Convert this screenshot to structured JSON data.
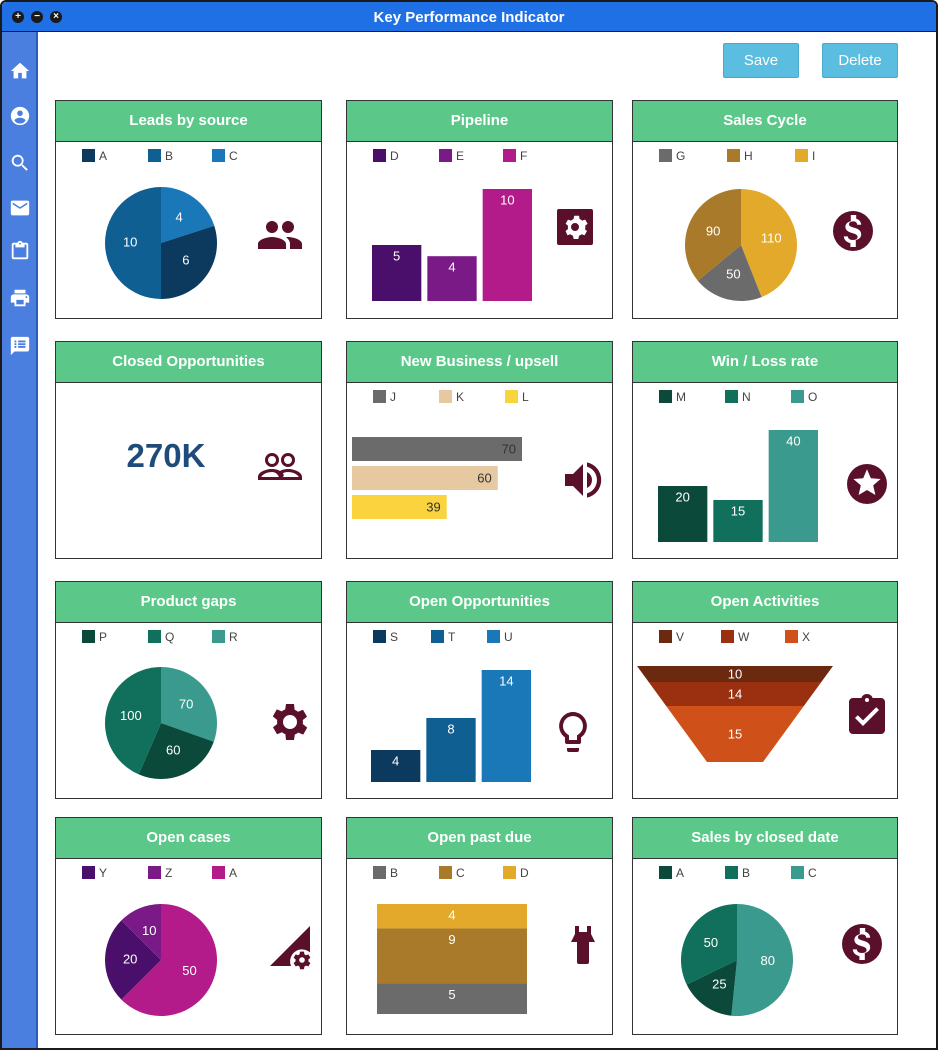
{
  "window": {
    "title": "Key Performance Indicator"
  },
  "toolbar": {
    "save_label": "Save",
    "delete_label": "Delete"
  },
  "sidebar": {
    "icons": [
      "home-icon",
      "user-circle-icon",
      "search-icon",
      "mail-icon",
      "clipboard-icon",
      "printer-icon",
      "message-list-icon"
    ]
  },
  "colors": {
    "header": "#5bc88a",
    "titlebar": "#1f6fe5",
    "sidebar": "#4a7fe0",
    "button": "#5bbddf",
    "icon": "#5a0f2b"
  },
  "panels": [
    {
      "title": "Leads by source",
      "legend": [
        "A",
        "B",
        "C"
      ],
      "icon": "people-icon"
    },
    {
      "title": "Pipeline",
      "legend": [
        "D",
        "E",
        "F"
      ],
      "icon": "gear-icon"
    },
    {
      "title": "Sales Cycle",
      "legend": [
        "G",
        "H",
        "I"
      ],
      "icon": "dollar-icon"
    },
    {
      "title": "Closed Opportunities",
      "legend": [],
      "icon": "people-outline-icon",
      "kpi": "270K"
    },
    {
      "title": "New Business / upsell",
      "legend": [
        "J",
        "K",
        "L"
      ],
      "icon": "speaker-icon"
    },
    {
      "title": "Win / Loss rate",
      "legend": [
        "M",
        "N",
        "O"
      ],
      "icon": "star-icon"
    },
    {
      "title": "Product gaps",
      "legend": [
        "P",
        "Q",
        "R"
      ],
      "icon": "gear-icon"
    },
    {
      "title": "Open Opportunities",
      "legend": [
        "S",
        "T",
        "U"
      ],
      "icon": "lightbulb-icon"
    },
    {
      "title": "Open Activities",
      "legend": [
        "V",
        "W",
        "X"
      ],
      "icon": "clipboard-check-icon"
    },
    {
      "title": "Open cases",
      "legend": [
        "Y",
        "Z",
        "A"
      ],
      "icon": "triangle-gear-icon"
    },
    {
      "title": "Open past due",
      "legend": [
        "B",
        "C",
        "D"
      ],
      "icon": "lamp-icon"
    },
    {
      "title": "Sales by closed date",
      "legend": [
        "A",
        "B",
        "C"
      ],
      "icon": "dollar-icon"
    }
  ],
  "chart_data": [
    {
      "type": "pie",
      "categories": [
        "A",
        "B",
        "C"
      ],
      "values": [
        6,
        10,
        4
      ],
      "colors": [
        "#0b3a5e",
        "#0f5f93",
        "#1a78b8"
      ]
    },
    {
      "type": "bar",
      "categories": [
        "D",
        "E",
        "F"
      ],
      "values": [
        5,
        4,
        10
      ],
      "colors": [
        "#4a0f6a",
        "#7a1a86",
        "#b31b8a"
      ]
    },
    {
      "type": "pie",
      "categories": [
        "G",
        "H",
        "I"
      ],
      "values": [
        50,
        90,
        110
      ],
      "colors": [
        "#6b6b6b",
        "#a87a2a",
        "#e3a92a"
      ]
    },
    {
      "type": "kpi",
      "value": "270K"
    },
    {
      "type": "bar",
      "orientation": "horizontal",
      "categories": [
        "J",
        "K",
        "L"
      ],
      "values": [
        70,
        60,
        39
      ],
      "colors": [
        "#6b6b6b",
        "#e6c9a0",
        "#fbd33f"
      ]
    },
    {
      "type": "bar",
      "categories": [
        "M",
        "N",
        "O"
      ],
      "values": [
        20,
        15,
        40
      ],
      "colors": [
        "#0b4a3a",
        "#10705c",
        "#3a9a8e"
      ]
    },
    {
      "type": "pie",
      "categories": [
        "P",
        "Q",
        "R"
      ],
      "values": [
        60,
        100,
        70
      ],
      "colors": [
        "#0b4a3a",
        "#10705c",
        "#3a9a8e"
      ]
    },
    {
      "type": "bar",
      "categories": [
        "S",
        "T",
        "U"
      ],
      "values": [
        4,
        8,
        14
      ],
      "colors": [
        "#0b3a5e",
        "#0f5f93",
        "#1a78b8"
      ]
    },
    {
      "type": "funnel",
      "categories": [
        "V",
        "W",
        "X"
      ],
      "values": [
        10,
        14,
        15
      ],
      "colors": [
        "#6b2a10",
        "#9a3010",
        "#d0501a"
      ]
    },
    {
      "type": "pie",
      "categories": [
        "Y",
        "Z",
        "A"
      ],
      "values": [
        20,
        10,
        50
      ],
      "colors": [
        "#4a0f6a",
        "#7a1a86",
        "#b31b8a"
      ]
    },
    {
      "type": "bar",
      "orientation": "stacked",
      "categories": [
        "B",
        "C",
        "D"
      ],
      "values": [
        5,
        9,
        4
      ],
      "colors": [
        "#6b6b6b",
        "#a87a2a",
        "#e3a92a"
      ]
    },
    {
      "type": "pie",
      "categories": [
        "A",
        "B",
        "C"
      ],
      "values": [
        25,
        50,
        80
      ],
      "colors": [
        "#0b4a3a",
        "#10705c",
        "#3a9a8e"
      ]
    }
  ]
}
